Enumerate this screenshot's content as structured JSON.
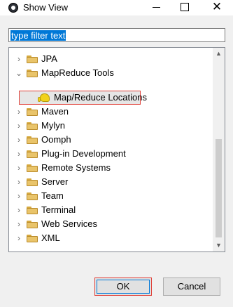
{
  "window": {
    "title": "Show View",
    "minimize_icon": "minimize-icon",
    "maximize_icon": "maximize-icon",
    "close_icon": "close-icon",
    "close_glyph": "✕"
  },
  "filter": {
    "value": "type filter text"
  },
  "tree": {
    "items": [
      {
        "label": "JPA",
        "expanded": false
      },
      {
        "label": "MapReduce Tools",
        "expanded": true
      },
      {
        "label": "Map/Reduce Locations",
        "child": true,
        "selected": true
      },
      {
        "label": "Maven",
        "expanded": false
      },
      {
        "label": "Mylyn",
        "expanded": false
      },
      {
        "label": "Oomph",
        "expanded": false
      },
      {
        "label": "Plug-in Development",
        "expanded": false
      },
      {
        "label": "Remote Systems",
        "expanded": false
      },
      {
        "label": "Server",
        "expanded": false
      },
      {
        "label": "Team",
        "expanded": false
      },
      {
        "label": "Terminal",
        "expanded": false
      },
      {
        "label": "Web Services",
        "expanded": false
      },
      {
        "label": "XML",
        "expanded": false
      }
    ],
    "chevron_collapsed": "›",
    "chevron_expanded": "⌄",
    "scroll_up_glyph": "▲",
    "scroll_down_glyph": "▼"
  },
  "buttons": {
    "ok_label": "OK",
    "cancel_label": "Cancel"
  },
  "colors": {
    "selection": "#0078d7",
    "highlight_border": "#e0413a",
    "folder": "#e9c46a"
  }
}
